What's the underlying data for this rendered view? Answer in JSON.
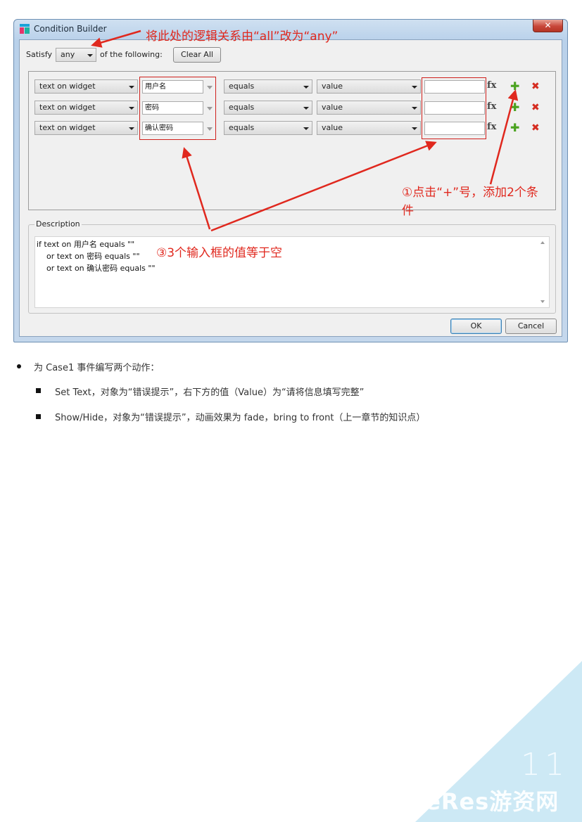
{
  "dialog": {
    "title": "Condition Builder",
    "close_glyph": "✕",
    "satisfy_label": "Satisfy",
    "satisfy_value": "any",
    "following_label": "of the following:",
    "clear_all": "Clear All",
    "rows": [
      {
        "source": "text on widget",
        "widget": "用户名",
        "operator": "equals",
        "type": "value",
        "value": "",
        "fx": "fx"
      },
      {
        "source": "text on widget",
        "widget": "密码",
        "operator": "equals",
        "type": "value",
        "value": "",
        "fx": "fx"
      },
      {
        "source": "text on widget",
        "widget": "确认密码",
        "operator": "equals",
        "type": "value",
        "value": "",
        "fx": "fx"
      }
    ],
    "description_label": "Description",
    "description_lines": [
      "if text on 用户名 equals \"\"",
      "    or text on 密码 equals \"\"",
      "    or text on 确认密码 equals \"\""
    ],
    "ok": "OK",
    "cancel": "Cancel"
  },
  "annotations": {
    "top": "将此处的逻辑关系由“all”改为“any”",
    "step1_line1": "①点击“+”号，添加2个条",
    "step1_line2": "件",
    "step3": "③3个输入框的值等于空",
    "color": "#e0281e"
  },
  "bullets": {
    "main": "为 Case1 事件编写两个动作：",
    "sub": [
      "Set Text，对象为“错误提示”，右下方的值（Value）为“请将信息填写完整”",
      "Show/Hide，对象为“错误提示”，动画效果为 fade，bring to front（上一章节的知识点）"
    ]
  },
  "footer": {
    "page_number": "11",
    "watermark": "GameRes游资网",
    "accent": "#c9e8f4"
  },
  "icons": {
    "app": "condition-builder-app-icon",
    "close": "close-icon",
    "dropdown": "chevron-down-icon",
    "add": "plus-icon",
    "delete": "delete-icon"
  }
}
